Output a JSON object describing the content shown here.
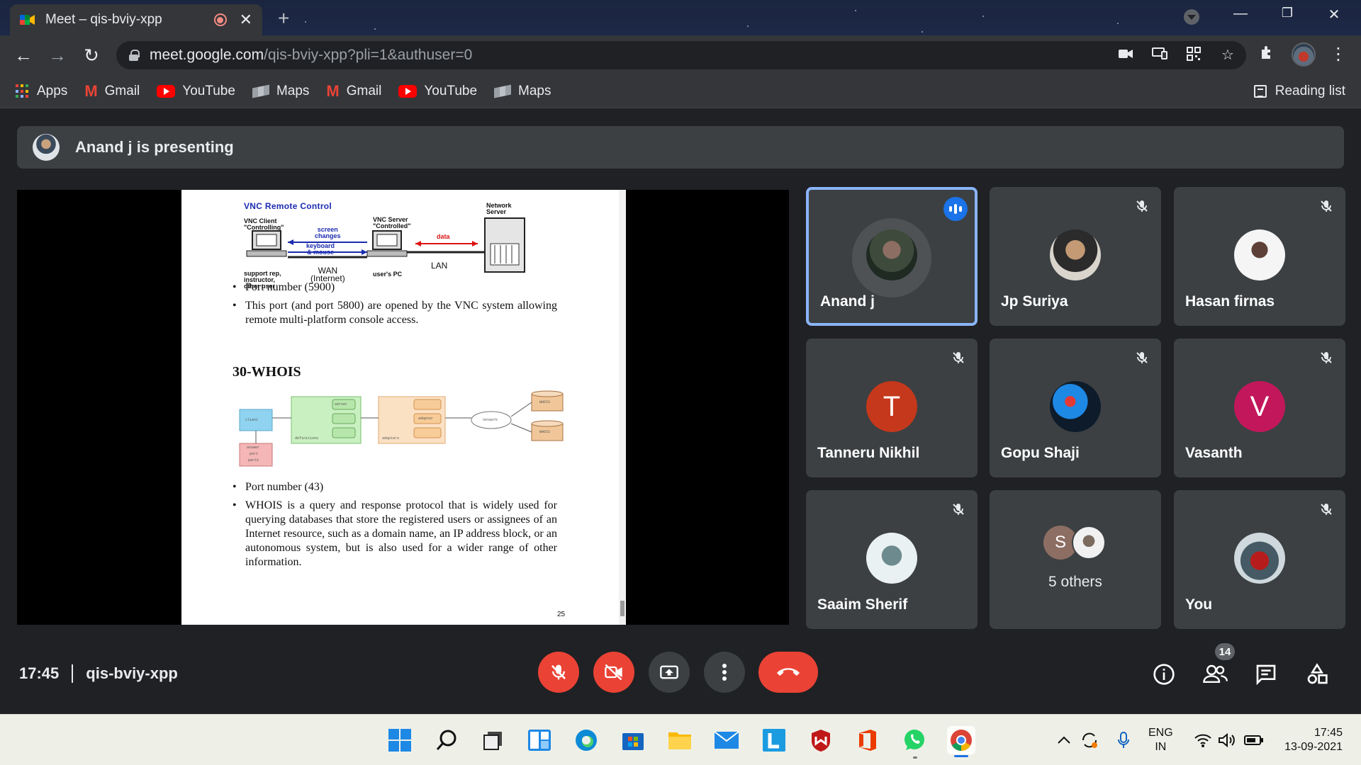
{
  "browser": {
    "tab_title": "Meet – qis-bviy-xpp",
    "url_host": "meet.google.com",
    "url_path": "/qis-bviy-xpp?pli=1&authuser=0",
    "bookmarks": [
      {
        "label": "Apps",
        "icon": "apps-icon"
      },
      {
        "label": "Gmail",
        "icon": "gmail-icon"
      },
      {
        "label": "YouTube",
        "icon": "youtube-icon"
      },
      {
        "label": "Maps",
        "icon": "maps-icon"
      },
      {
        "label": "Gmail",
        "icon": "gmail-icon"
      },
      {
        "label": "YouTube",
        "icon": "youtube-icon"
      },
      {
        "label": "Maps",
        "icon": "maps-icon"
      }
    ],
    "reading_list": "Reading list"
  },
  "meet": {
    "presenting_text": "Anand j is presenting",
    "meeting_time": "17:45",
    "meeting_code": "qis-bviy-xpp",
    "people_count": "14",
    "participants": [
      {
        "name": "Anand j",
        "state": "speaking",
        "avatar": "photo"
      },
      {
        "name": "Jp Suriya",
        "state": "muted",
        "avatar": "photo"
      },
      {
        "name": "Hasan firnas",
        "state": "muted",
        "avatar": "photo"
      },
      {
        "name": "Tanneru Nikhil",
        "state": "muted",
        "avatar": "T",
        "avatar_color": "#c5381b"
      },
      {
        "name": "Gopu Shaji",
        "state": "muted",
        "avatar": "photo"
      },
      {
        "name": "Vasanth",
        "state": "muted",
        "avatar": "V",
        "avatar_color": "#c2185b"
      },
      {
        "name": "Saaim Sherif",
        "state": "muted",
        "avatar": "photo"
      },
      {
        "name": "5 others",
        "state": "group",
        "avatar": "S",
        "avatar_color": "#8d6e63"
      },
      {
        "name": "You",
        "state": "muted",
        "avatar": "photo"
      }
    ]
  },
  "slide": {
    "vnc_title": "VNC Remote Control",
    "vnc_client": "VNC Client\n\"Controlling\"",
    "vnc_server": "VNC Server\n\"Controlled\"",
    "network_server": "Network\nServer",
    "screen_changes": "screen\nchanges",
    "keyboard_mouse": "keyboard\n& mouse",
    "data_label": "data",
    "wan_label": "WAN\n(Internet)",
    "lan_label": "LAN",
    "support_label": "support rep,\ninstructor,\nother user",
    "users_pc": "user's PC",
    "bullet1": "Port number (5900)",
    "bullet2": "This port (and port 5800) are opened by the VNC system allowing remote multi-platform console access.",
    "section_title": "30-WHOIS",
    "bullet3": "Port number (43)",
    "bullet4": "WHOIS is a query and response protocol that is widely used for querying databases that store the registered users or assignees of an Internet resource, such as a domain name, an IP address block, or an autonomous system, but is also used for a wider range of other information.",
    "page_number": "25",
    "whois_labels": {
      "client": "client",
      "server": "server",
      "definitions": "definitions",
      "adapter": "adapter",
      "adapters": "adapters",
      "network": "network",
      "whois1": "WHOIS",
      "whois2": "WHOIS",
      "answer": "answer",
      "port": "port",
      "parts": "parts"
    }
  },
  "taskbar": {
    "lang_top": "ENG",
    "lang_bottom": "IN",
    "clock_time": "17:45",
    "clock_date": "13-09-2021"
  }
}
